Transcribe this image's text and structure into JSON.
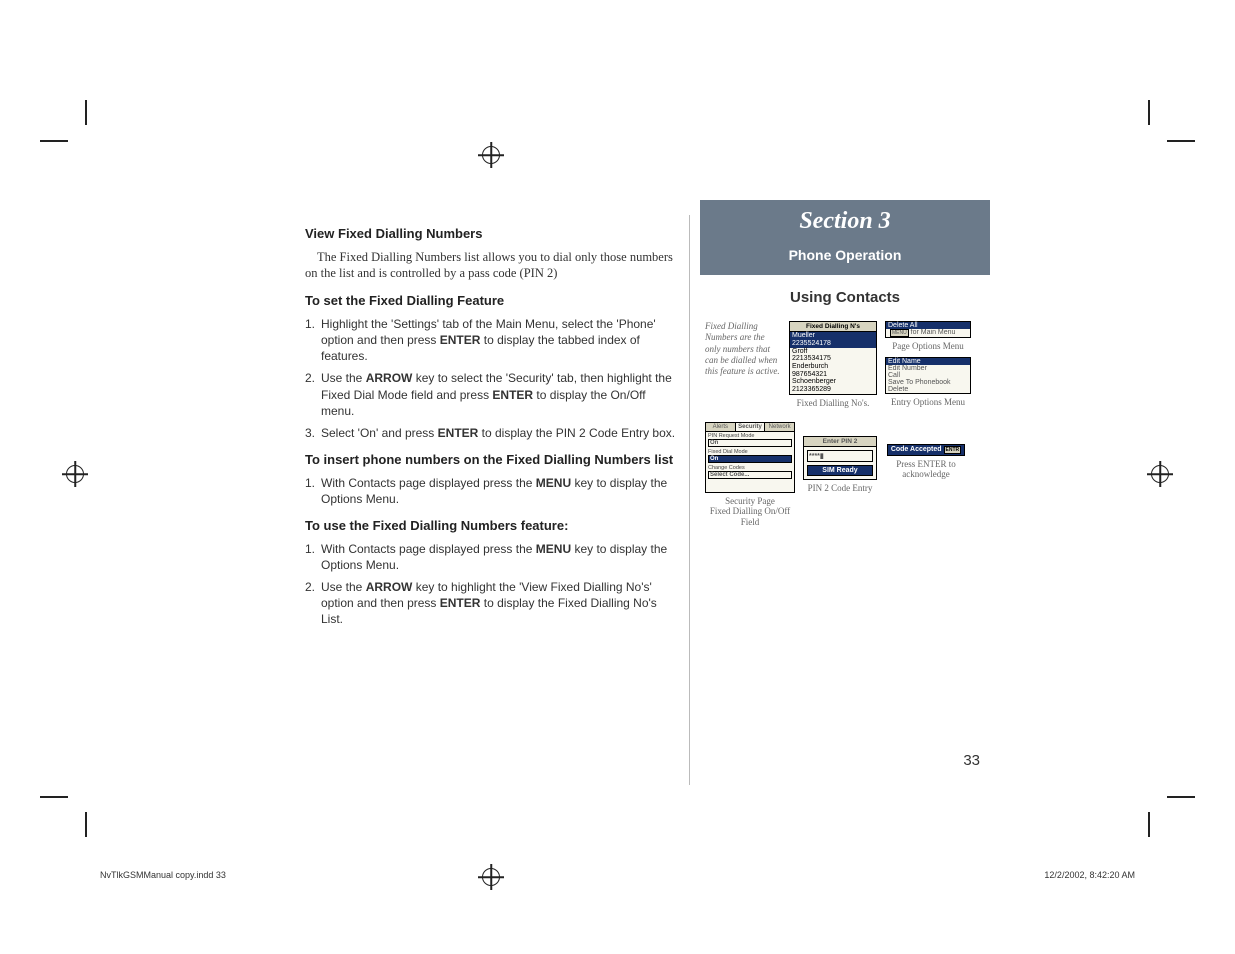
{
  "section": {
    "label": "Section 3",
    "title": "Phone Operation",
    "subsection": "Using Contacts"
  },
  "left": {
    "h1": "View Fixed Dialling Numbers",
    "intro": "The Fixed Dialling Numbers list allows you to dial only those numbers on the list and is controlled by a pass code (PIN 2)",
    "h2a": "To set the Fixed Dialling Feature",
    "steps_a": [
      {
        "n": "1.",
        "t_pre": "Highlight the 'Settings' tab of the Main Menu, select the 'Phone' option and then press ",
        "t_k": "ENTER",
        "t_post": " to display the tabbed index of features."
      },
      {
        "n": "2.",
        "t_pre": "Use the ",
        "t_k": "ARROW",
        "t_mid": " key to select the 'Security' tab, then highlight the Fixed Dial Mode field and press ",
        "t_k2": "ENTER",
        "t_post": " to display the On/Off menu."
      },
      {
        "n": "3.",
        "t_pre": "Select 'On' and press ",
        "t_k": "ENTER",
        "t_post": " to display the PIN 2 Code Entry box."
      }
    ],
    "h2b": "To insert phone numbers on the Fixed Dialling Numbers list",
    "steps_b": [
      {
        "n": "1.",
        "t_pre": "With Contacts page displayed press the ",
        "t_k": "MENU",
        "t_post": " key to display the Options Menu."
      }
    ],
    "h2c": "To use the Fixed Dialling Numbers feature:",
    "steps_c": [
      {
        "n": "1.",
        "t_pre": "With Contacts page displayed press the ",
        "t_k": "MENU",
        "t_post": " key to display the Options Menu."
      },
      {
        "n": "2.",
        "t_pre": "Use the ",
        "t_k": "ARROW",
        "t_mid": " key to highlight the 'View Fixed Dialling No's' option and then press ",
        "t_k2": "ENTER",
        "t_post": " to display the Fixed Dialling No's List."
      }
    ]
  },
  "right": {
    "fig1": {
      "side_note": "Fixed Dialling Numbers are the only numbers that can be dialled when this feature is active.",
      "list_title": "Fixed Dialling N's",
      "entries": [
        {
          "name": "Mueller",
          "num": "2235524178",
          "sel": true
        },
        {
          "name": "Groff",
          "num": "2213534175",
          "sel": false
        },
        {
          "name": "Enderburch",
          "num": "987654321",
          "sel": false
        },
        {
          "name": "Schoenberger",
          "num": "2123365289",
          "sel": false
        }
      ],
      "list_caption": "Fixed Dialling No's.",
      "page_menu": {
        "items": [
          "Delete All"
        ],
        "hint_pre": "MENU",
        "hint": " for Main Menu",
        "caption": "Page Options Menu"
      },
      "entry_menu": {
        "items": [
          "Edit Name",
          "Edit Number",
          "Call",
          "Save To Phonebook",
          "Delete"
        ],
        "caption": "Entry Options Menu"
      }
    },
    "fig2": {
      "sec_tabs": [
        "Alerts",
        "Security",
        "Network"
      ],
      "fields": [
        {
          "label": "PIN Request Mode",
          "value": "On",
          "sel": false
        },
        {
          "label": "Fixed Dial Mode",
          "value": "On",
          "sel": true
        },
        {
          "label": "Change Codes",
          "value": "Select Code...",
          "sel": false
        }
      ],
      "sec_caption_line1": "Security Page",
      "sec_caption_line2": "Fixed Dialling On/Off Field",
      "pin_title": "Enter PIN 2",
      "pin_value": "****▮",
      "pin_status": "SIM Ready",
      "pin_caption": "PIN 2 Code Entry",
      "ok_label": "Code Accepted",
      "ok_badge": "ENTR",
      "ok_caption_line1": "Press ENTER to",
      "ok_caption_line2": "acknowledge"
    }
  },
  "page_number": "33",
  "footer": {
    "left": "NvTlkGSMManual copy.indd   33",
    "right": "12/2/2002, 8:42:20 AM"
  }
}
